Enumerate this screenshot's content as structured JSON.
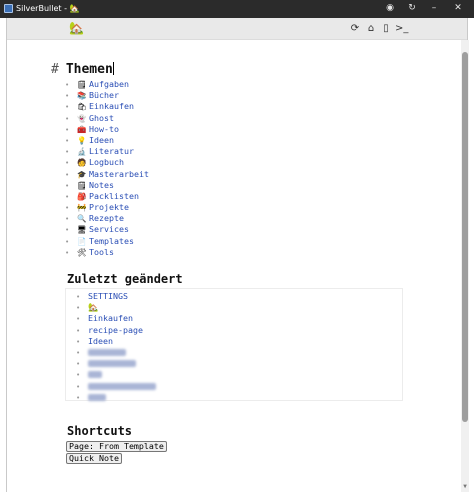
{
  "window": {
    "title": "SilverBullet - 🏡"
  },
  "app": {
    "page_name": "🏡",
    "actions": [
      {
        "name": "sync-icon",
        "glyph": "⟳"
      },
      {
        "name": "home-icon",
        "glyph": "⌂"
      },
      {
        "name": "book-icon",
        "glyph": "▯"
      },
      {
        "name": "terminal-icon",
        "glyph": ">_"
      }
    ]
  },
  "main": {
    "heading_marker": "#",
    "heading": "Themen",
    "topics": [
      {
        "emoji": "🗒",
        "label": "Aufgaben"
      },
      {
        "emoji": "📚",
        "label": "Bücher"
      },
      {
        "emoji": "🛍",
        "label": "Einkaufen"
      },
      {
        "emoji": "👻",
        "label": "Ghost"
      },
      {
        "emoji": "🧰",
        "label": "How-to"
      },
      {
        "emoji": "💡",
        "label": "Ideen"
      },
      {
        "emoji": "🔬",
        "label": "Literatur"
      },
      {
        "emoji": "🧑",
        "label": "Logbuch"
      },
      {
        "emoji": "🎓",
        "label": "Masterarbeit"
      },
      {
        "emoji": "🗒",
        "label": "Notes"
      },
      {
        "emoji": "🎒",
        "label": "Packlisten"
      },
      {
        "emoji": "🚧",
        "label": "Projekte"
      },
      {
        "emoji": "🔍",
        "label": "Rezepte"
      },
      {
        "emoji": "🖥",
        "label": "Services"
      },
      {
        "emoji": "📄",
        "label": "Templates"
      },
      {
        "emoji": "🛠",
        "label": "Tools"
      }
    ],
    "recent_heading": "Zuletzt geändert",
    "recent": [
      {
        "label": "SETTINGS"
      },
      {
        "label": "🏡"
      },
      {
        "label": "Einkaufen"
      },
      {
        "label": "recipe-page"
      },
      {
        "label": "Ideen"
      }
    ],
    "recent_blurred_count": 5,
    "shortcuts_heading": "Shortcuts",
    "shortcuts": [
      {
        "label": "Page: From Template"
      },
      {
        "label": "Quick Note"
      }
    ]
  }
}
